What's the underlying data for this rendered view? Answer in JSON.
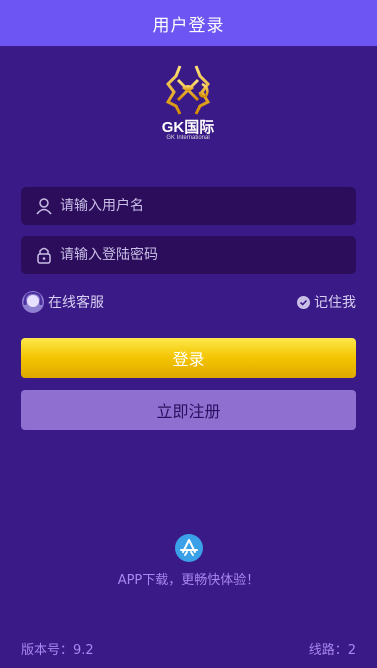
{
  "header": {
    "title": "用户登录"
  },
  "logo": {
    "name": "GK国际",
    "subtitle": "GK International"
  },
  "form": {
    "username_placeholder": "请输入用户名",
    "password_placeholder": "请输入登陆密码",
    "online_service": "在线客服",
    "remember_me": "记住我",
    "login_label": "登录",
    "register_label": "立即注册"
  },
  "app": {
    "download_text": "APP下载，更畅快体验！"
  },
  "footer": {
    "version_label": "版本号：9.2",
    "line_label": "线路：2"
  },
  "colors": {
    "background": "#3a1a86",
    "header": "#6c55f2",
    "field": "#2b0d5c",
    "login_button": "#f3c400",
    "register_button": "#8f6fd0"
  }
}
